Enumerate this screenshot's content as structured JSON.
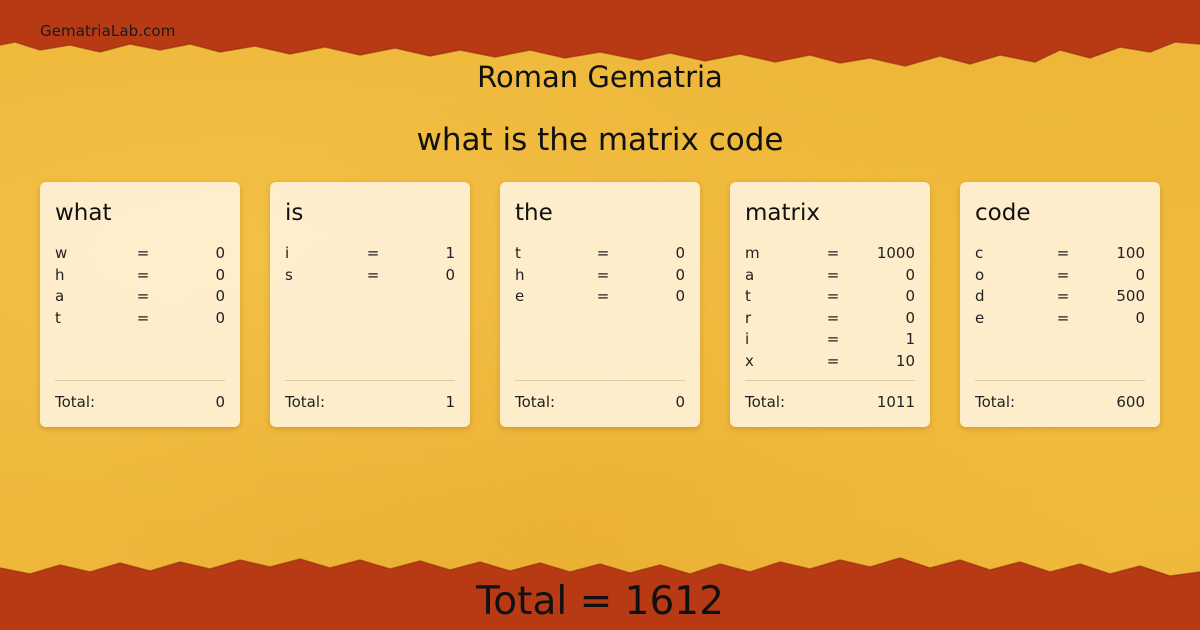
{
  "site": "GematriaLab.com",
  "title": "Roman Gematria",
  "phrase": "what is the matrix code",
  "words": [
    {
      "word": "what",
      "letters": [
        {
          "l": "w",
          "eq": "=",
          "v": "0"
        },
        {
          "l": "h",
          "eq": "=",
          "v": "0"
        },
        {
          "l": "a",
          "eq": "=",
          "v": "0"
        },
        {
          "l": "t",
          "eq": "=",
          "v": "0"
        }
      ],
      "total_label": "Total:",
      "total": "0"
    },
    {
      "word": "is",
      "letters": [
        {
          "l": "i",
          "eq": "=",
          "v": "1"
        },
        {
          "l": "s",
          "eq": "=",
          "v": "0"
        }
      ],
      "total_label": "Total:",
      "total": "1"
    },
    {
      "word": "the",
      "letters": [
        {
          "l": "t",
          "eq": "=",
          "v": "0"
        },
        {
          "l": "h",
          "eq": "=",
          "v": "0"
        },
        {
          "l": "e",
          "eq": "=",
          "v": "0"
        }
      ],
      "total_label": "Total:",
      "total": "0"
    },
    {
      "word": "matrix",
      "letters": [
        {
          "l": "m",
          "eq": "=",
          "v": "1000"
        },
        {
          "l": "a",
          "eq": "=",
          "v": "0"
        },
        {
          "l": "t",
          "eq": "=",
          "v": "0"
        },
        {
          "l": "r",
          "eq": "=",
          "v": "0"
        },
        {
          "l": "i",
          "eq": "=",
          "v": "1"
        },
        {
          "l": "x",
          "eq": "=",
          "v": "10"
        }
      ],
      "total_label": "Total:",
      "total": "1011"
    },
    {
      "word": "code",
      "letters": [
        {
          "l": "c",
          "eq": "=",
          "v": "100"
        },
        {
          "l": "o",
          "eq": "=",
          "v": "0"
        },
        {
          "l": "d",
          "eq": "=",
          "v": "500"
        },
        {
          "l": "e",
          "eq": "=",
          "v": "0"
        }
      ],
      "total_label": "Total:",
      "total": "600"
    }
  ],
  "grand_total": "Total = 1612",
  "colors": {
    "background": "#eeb73a",
    "band": "#b83a14",
    "card": "#fff6e4"
  }
}
